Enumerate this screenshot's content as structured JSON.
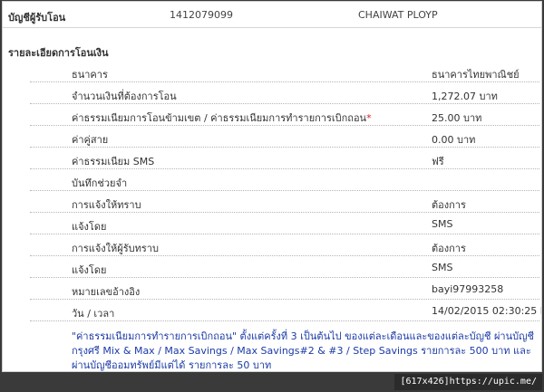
{
  "recipient": {
    "label": "บัญชีผู้รับโอน",
    "account_number": "1412079099",
    "account_name": "CHAIWAT PLOYP"
  },
  "details": {
    "title": "รายละเอียดการโอนเงิน",
    "rows": [
      {
        "label": "ธนาคาร",
        "value": "ธนาคารไทยพาณิชย์"
      },
      {
        "label": "จำนวนเงินที่ต้องการโอน",
        "value": "1,272.07 บาท"
      },
      {
        "label": "ค่าธรรมเนียมการโอนข้ามเขต / ค่าธรรมเนียมการทำรายการเบิกถอน",
        "value": "25.00 บาท"
      },
      {
        "label": "ค่าคู่สาย",
        "value": "0.00 บาท"
      },
      {
        "label": "ค่าธรรมเนียม SMS",
        "value": "ฟรี"
      },
      {
        "label": "บันทึกช่วยจำ",
        "value": ""
      },
      {
        "label": "การแจ้งให้ทราบ",
        "value": "ต้องการ"
      },
      {
        "label": "แจ้งโดย",
        "value": "SMS"
      },
      {
        "label": "การแจ้งให้ผู้รับทราบ",
        "value": "ต้องการ"
      },
      {
        "label": "แจ้งโดย",
        "value": "SMS"
      },
      {
        "label": "หมายเลขอ้างอิง",
        "value": "bayi97993258"
      },
      {
        "label": "วัน / เวลา",
        "value": "14/02/2015 02:30:25 PM"
      }
    ],
    "required_marker": "*"
  },
  "footnote": "\"ค่าธรรมเนียมการทำรายการเบิกถอน\" ตั้งแต่ครั้งที่ 3 เป็นต้นไป ของแต่ละเดือนและของแต่ละบัญชี ผ่านบัญชีกรุงศรี Mix & Max / Max Savings / Max Savings#2 & #3 / Step Savings รายการละ 500 บาท และผ่านบัญชีออมทรัพย์มีแต่ได้ รายการละ 50 บาท",
  "watermark": "[617x426]https://upic.me/"
}
